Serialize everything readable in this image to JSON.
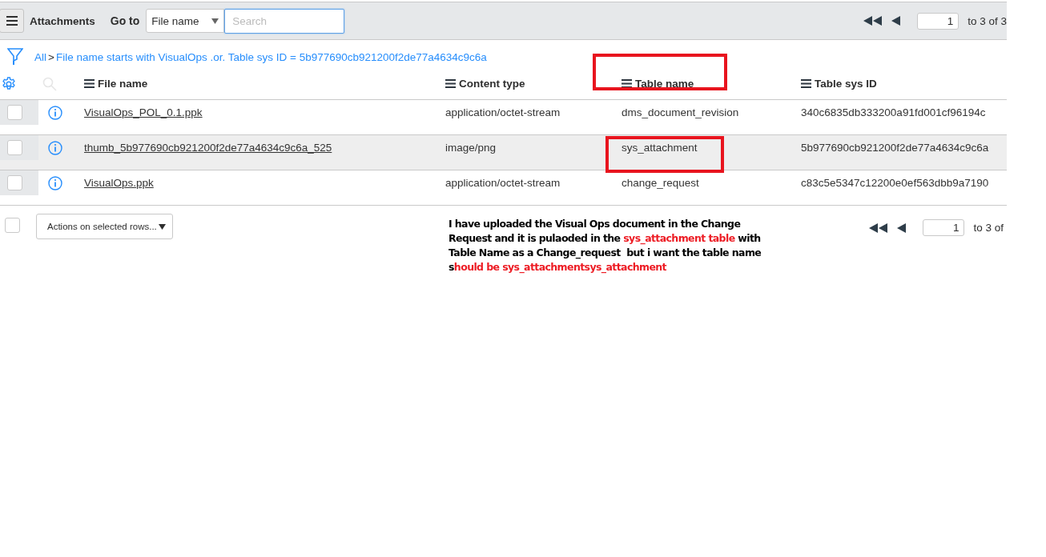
{
  "toolbar": {
    "title": "Attachments",
    "goto_label": "Go to",
    "goto_field": "File name",
    "search": {
      "placeholder": "Search"
    },
    "page": "1",
    "range": "to 3 of 3"
  },
  "breadcrumb": {
    "root": "All",
    "separator": ">",
    "filter": "File name starts with VisualOps .or. Table sys ID = 5b977690cb921200f2de77a4634c9c6a"
  },
  "columns": [
    {
      "label": "File name",
      "highlighted": false
    },
    {
      "label": "Content type",
      "highlighted": false
    },
    {
      "label": "Table name",
      "highlighted": true
    },
    {
      "label": "Table sys ID",
      "highlighted": false
    }
  ],
  "rows": [
    {
      "file_name": "VisualOps_POL_0.1.ppk",
      "content_type": "application/octet-stream",
      "table_name": "dms_document_revision",
      "table_sys_id": "340c6835db333200a91fd001cf96194c",
      "checked": false,
      "hovered": false,
      "highlighted": false
    },
    {
      "file_name": "thumb_5b977690cb921200f2de77a4634c9c6a_525",
      "content_type": "image/png",
      "table_name": "sys_attachment",
      "table_sys_id": "5b977690cb921200f2de77a4634c9c6a",
      "checked": false,
      "hovered": true,
      "highlighted": true
    },
    {
      "file_name": "VisualOps.ppk",
      "content_type": "application/octet-stream",
      "table_name": "change_request",
      "table_sys_id": "c83c5e5347c12200e0ef563dbb9a7190",
      "checked": false,
      "hovered": false,
      "highlighted": false
    }
  ],
  "footer": {
    "select_all_checked": false,
    "actions": "Actions on selected rows...",
    "page": "1",
    "range": "to 3 of"
  },
  "note": [
    {
      "text": "I have uploaded the Visual Ops document in the Change Request and it is pulaoded in the ",
      "highlight": false
    },
    {
      "text": "sys_attachment table",
      "highlight": true
    },
    {
      "text": " with Table Name as a Change_request  but i want the table name s",
      "highlight": false
    },
    {
      "text": "hould be sys_attachmentsys_attachment",
      "highlight": true
    }
  ]
}
